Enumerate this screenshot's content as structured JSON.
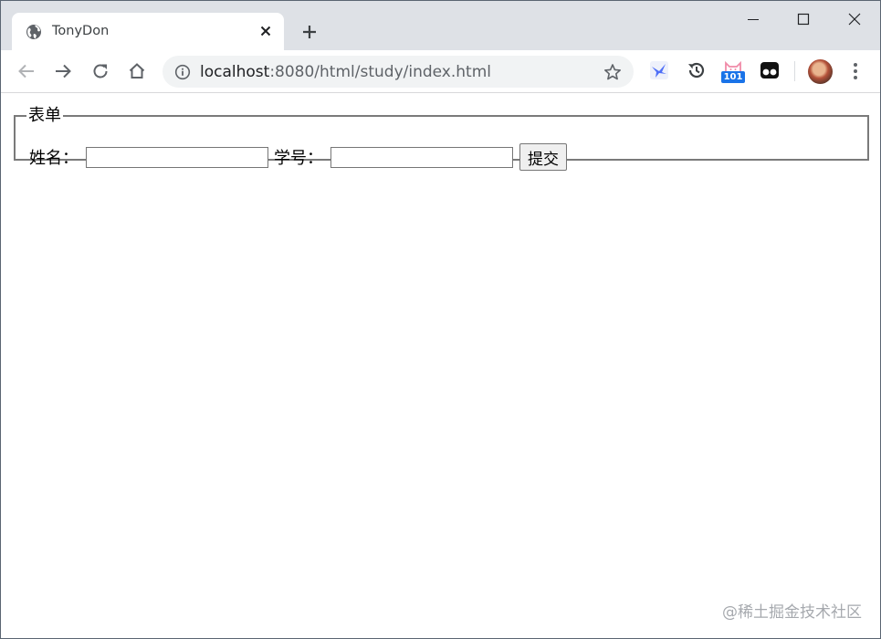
{
  "browser": {
    "tab": {
      "title": "TonyDon"
    },
    "address_bar": {
      "host": "localhost",
      "path": ":8080/html/study/index.html"
    },
    "extensions": [
      {
        "name": "bird-extension-icon"
      },
      {
        "name": "history-extension-icon"
      },
      {
        "name": "cat-extension-icon",
        "badge": "101"
      },
      {
        "name": "tampermonkey-extension-icon"
      }
    ]
  },
  "page": {
    "form": {
      "legend": "表单",
      "name_label": "姓名：",
      "name_value": "",
      "student_id_label": "学号：",
      "student_id_value": "",
      "submit_label": "提交"
    },
    "watermark": "@稀土掘金技术社区"
  },
  "colors": {
    "tabstrip": "#dee1e6",
    "omnibox": "#f1f3f4",
    "badge": "#1a73e8",
    "fieldset_border": "#7a7a7a"
  }
}
